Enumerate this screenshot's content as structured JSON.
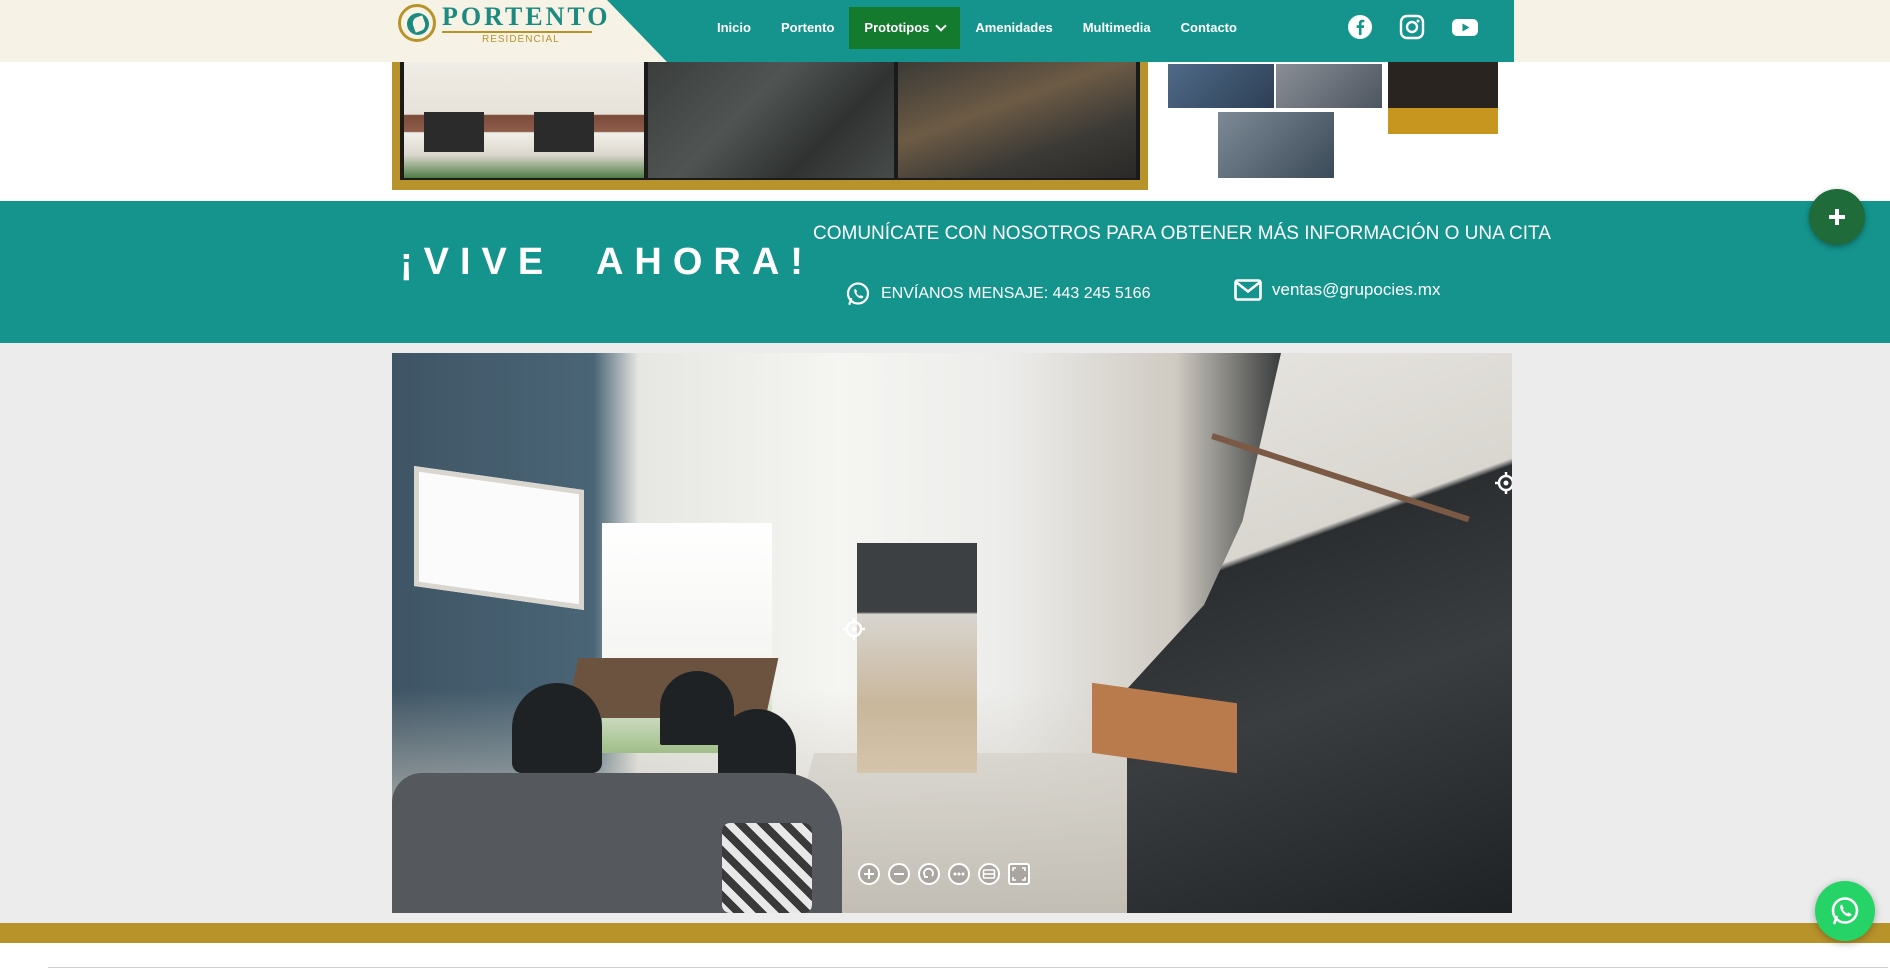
{
  "brand": {
    "name": "PORTENTO",
    "tagline": "RESIDENCIAL",
    "colors": {
      "teal": "#14948c",
      "gold": "#b8932a",
      "green": "#137a2e",
      "cream": "#f6f3e6"
    }
  },
  "nav": {
    "items": [
      {
        "label": "Inicio",
        "active": false
      },
      {
        "label": "Portento",
        "active": false
      },
      {
        "label": "Prototipos",
        "active": true,
        "has_dropdown": true
      },
      {
        "label": "Amenidades",
        "active": false
      },
      {
        "label": "Multimedia",
        "active": false
      },
      {
        "label": "Contacto",
        "active": false
      }
    ],
    "social": [
      "facebook-icon",
      "instagram-icon",
      "youtube-icon"
    ]
  },
  "cta": {
    "headline": "¡VIVE  AHORA!",
    "title": "COMUNÍCATE CON NOSOTROS PARA OBTENER MÁS INFORMACIÓN O UNA CITA",
    "phone_label": "ENVÍANOS MENSAJE: 443 245 5166",
    "email": "ventas@grupocies.mx"
  },
  "panorama": {
    "controls": [
      "zoom-in-icon",
      "zoom-out-icon",
      "auto-rotate-icon",
      "more-icon",
      "gyroscope-icon",
      "fullscreen-icon"
    ]
  }
}
